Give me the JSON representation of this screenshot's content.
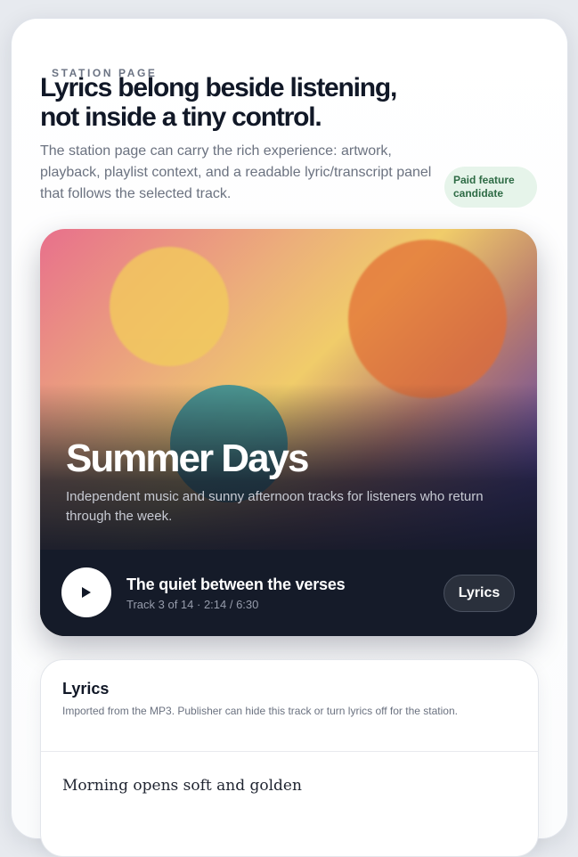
{
  "header": {
    "eyebrow": "STATION PAGE",
    "title_line1": "Lyrics belong beside listening,",
    "title_line2": "not inside a tiny control.",
    "description": "The station page can carry the rich experience: artwork, playback, playlist context, and a readable lyric/transcript panel that follows the selected track.",
    "badge_line1": "Paid feature",
    "badge_line2": "candidate"
  },
  "station": {
    "title": "Summer Days",
    "description": "Independent music and sunny afternoon tracks for listeners who return through the week."
  },
  "player": {
    "play_icon": "play-icon",
    "track_title": "The quiet between the verses",
    "track_meta": "Track 3 of 14 · 2:14 / 6:30",
    "lyrics_button_label": "Lyrics"
  },
  "lyrics_panel": {
    "heading": "Lyrics",
    "note": "Imported from the MP3. Publisher can hide this track or turn lyrics off for the station.",
    "first_line": "Morning opens soft and golden"
  },
  "colors": {
    "accent_badge_bg": "#e6f4ea",
    "accent_badge_text": "#2e6b45",
    "player_bg": "#151b29"
  }
}
